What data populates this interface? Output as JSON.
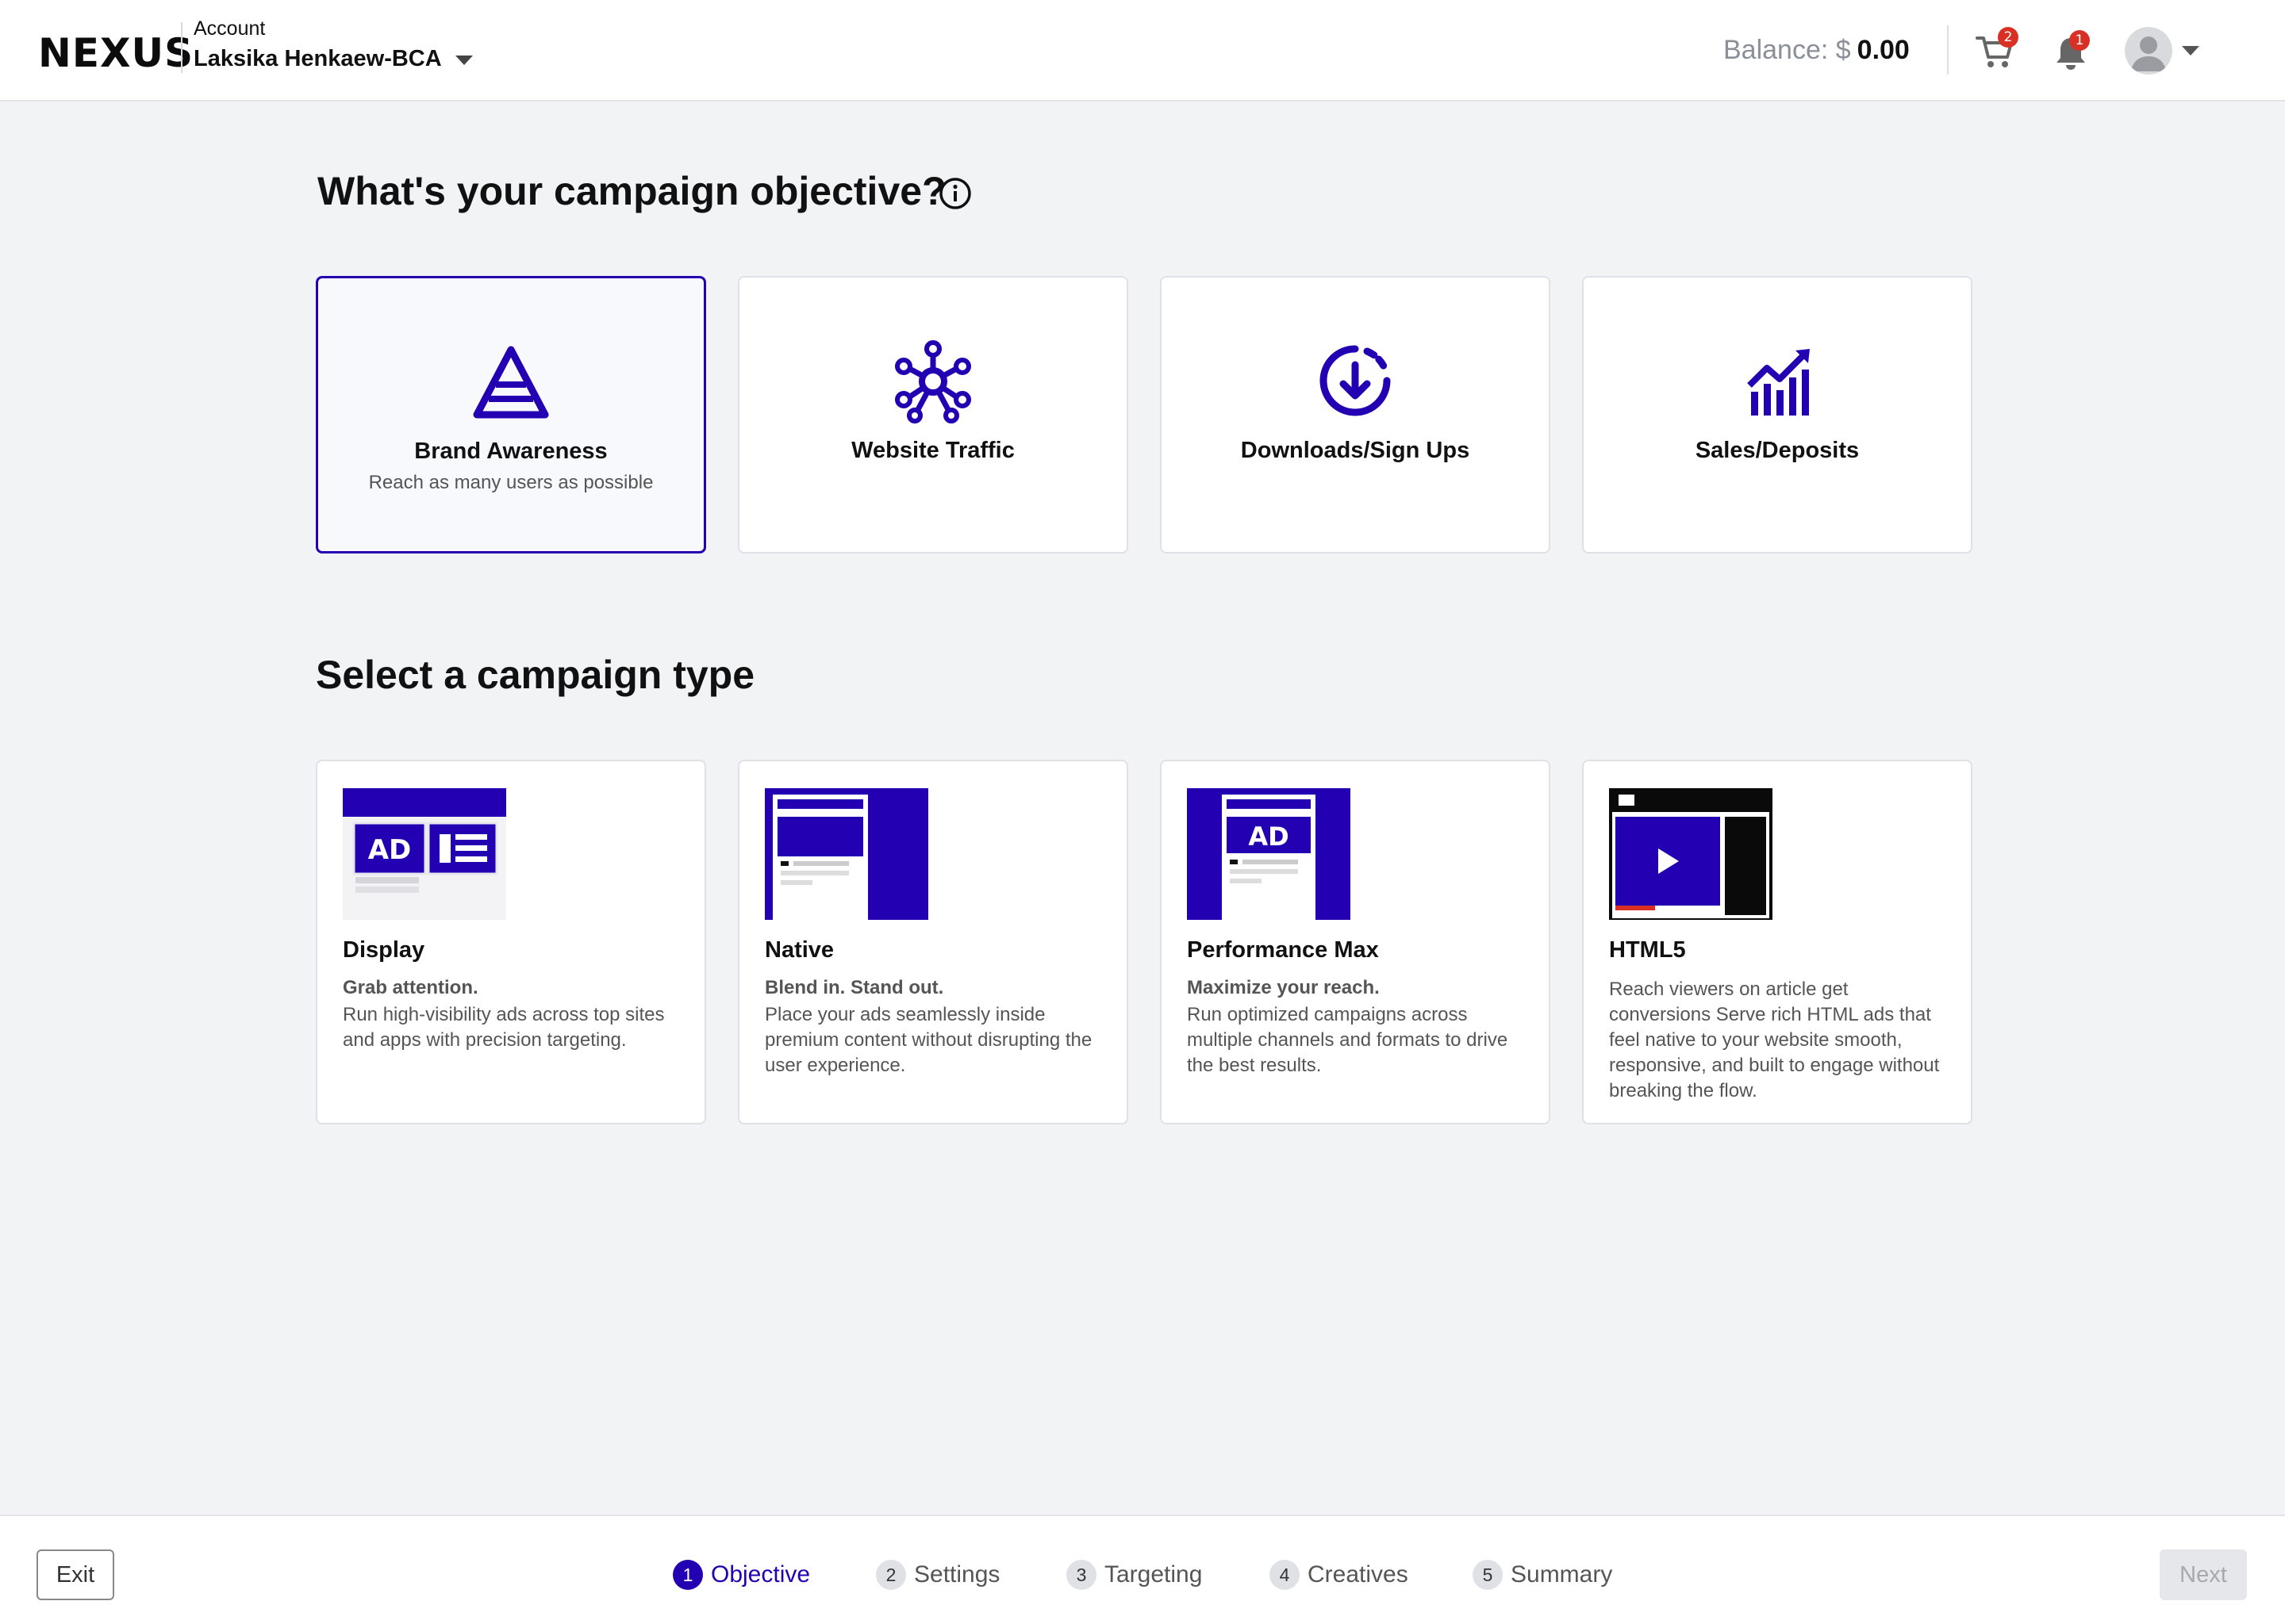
{
  "header": {
    "logo": "NEXUS",
    "account_label": "Account",
    "account_name": "Laksika Henkaew-BCA",
    "balance_label": "Balance: $",
    "balance_value": "0.00",
    "cart_count": "2",
    "notification_count": "1"
  },
  "objective": {
    "heading": "What's your campaign objective?",
    "options": [
      {
        "title": "Brand Awareness",
        "subtitle": "Reach as many users as possible",
        "icon": "pyramid-icon",
        "selected": true
      },
      {
        "title": "Website Traffic",
        "subtitle": "",
        "icon": "network-hub-icon",
        "selected": false
      },
      {
        "title": "Downloads/Sign Ups",
        "subtitle": "",
        "icon": "download-circle-icon",
        "selected": false
      },
      {
        "title": "Sales/Deposits",
        "subtitle": "",
        "icon": "growth-chart-icon",
        "selected": false
      }
    ]
  },
  "campaign_type": {
    "heading": "Select a campaign type",
    "options": [
      {
        "title": "Display",
        "tagline": "Grab attention.",
        "description": "Run high-visibility ads across top sites and apps with precision targeting."
      },
      {
        "title": "Native",
        "tagline": "Blend in. Stand out.",
        "description": "Place your ads seamlessly inside premium content without disrupting the user experience."
      },
      {
        "title": "Performance Max",
        "tagline": "Maximize your reach.",
        "description": "Run optimized campaigns across multiple channels and formats to drive the best results."
      },
      {
        "title": "HTML5",
        "tagline": "",
        "description": "Reach viewers on article get conversions Serve rich HTML ads that feel native to your website smooth, responsive, and built to engage without breaking the flow."
      }
    ]
  },
  "footer": {
    "exit_label": "Exit",
    "next_label": "Next",
    "steps": [
      {
        "num": "1",
        "label": "Objective",
        "active": true
      },
      {
        "num": "2",
        "label": "Settings",
        "active": false
      },
      {
        "num": "3",
        "label": "Targeting",
        "active": false
      },
      {
        "num": "4",
        "label": "Creatives",
        "active": false
      },
      {
        "num": "5",
        "label": "Summary",
        "active": false
      }
    ]
  },
  "colors": {
    "brand": "#2400b3",
    "badge": "#d93025",
    "background": "#f2f3f5"
  }
}
